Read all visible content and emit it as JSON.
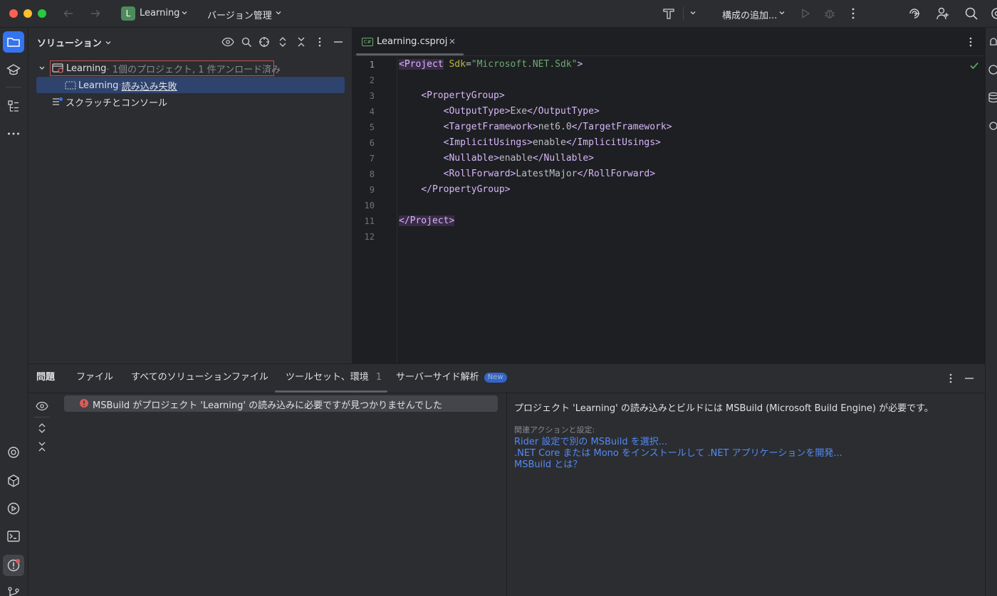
{
  "titlebar": {
    "project_initial": "L",
    "project_name": "Learning",
    "vcs_label": "バージョン管理",
    "run_config_label": "構成の追加..."
  },
  "solution": {
    "title": "ソリューション",
    "tree": {
      "root_name": "Learning",
      "root_detail": " · 1個のプロジェクト, 1 件アンロード済み",
      "child_name": "Learning",
      "child_sep": " · ",
      "child_status": "読み込み失敗",
      "scratch_label": "スクラッチとコンソール"
    }
  },
  "editor": {
    "tab_label": "Learning.csproj",
    "tab_icon_text": "C#",
    "line_numbers": [
      "1",
      "2",
      "3",
      "4",
      "5",
      "6",
      "7",
      "8",
      "9",
      "10",
      "11",
      "12"
    ],
    "code": {
      "l1_open": "<Project",
      "l1_attr": "Sdk",
      "l1_eq": "=",
      "l1_val": "\"Microsoft.NET.Sdk\"",
      "l1_close": ">",
      "l3": "<PropertyGroup>",
      "l4_open": "<OutputType>",
      "l4_text": "Exe",
      "l4_close": "</OutputType>",
      "l5_open": "<TargetFramework>",
      "l5_text": "net6.0",
      "l5_close": "</TargetFramework>",
      "l6_open": "<ImplicitUsings>",
      "l6_text": "enable",
      "l6_close": "</ImplicitUsings>",
      "l7_open": "<Nullable>",
      "l7_text": "enable",
      "l7_close": "</Nullable>",
      "l8_open": "<RollForward>",
      "l8_text": "LatestMajor",
      "l8_close": "</RollForward>",
      "l9": "</PropertyGroup>",
      "l11": "</Project>"
    }
  },
  "bottom": {
    "tabs": {
      "problems": "問題",
      "file": "ファイル",
      "all_solution_files": "すべてのソリューションファイル",
      "toolset": "ツールセット、環境",
      "toolset_count": "1",
      "server_side": "サーバーサイド解析",
      "new_badge": "New"
    },
    "problem_item": "MSBuild がプロジェクト 'Learning' の読み込みに必要ですが見つかりませんでした",
    "detail": {
      "message": "プロジェクト 'Learning' の読み込みとビルドには MSBuild (Microsoft Build Engine) が必要です。",
      "related_label": "関連アクションと設定:",
      "link1": "Rider 設定で別の MSBuild を選択...",
      "link2": ".NET Core または Mono をインストールして .NET アプリケーションを開発...",
      "link3": "MSBuild とは？"
    }
  },
  "colors": {
    "accent": "#3574f0",
    "selection": "#2e436e",
    "error": "#db5c5c",
    "link": "#548af7",
    "tag": "#d5b8f9",
    "string": "#6aab73"
  },
  "icons": [
    "folder-icon",
    "learn-icon",
    "structure-icon",
    "more-icon",
    "ai-icon",
    "nuget-icon",
    "services-icon",
    "terminal-icon",
    "problems-icon",
    "git-icon",
    "eye-icon",
    "expand-icon",
    "collapse-icon",
    "error-icon",
    "hammer-icon",
    "run-icon",
    "debug-icon",
    "search-icon",
    "add-user-icon",
    "settings-icon"
  ]
}
